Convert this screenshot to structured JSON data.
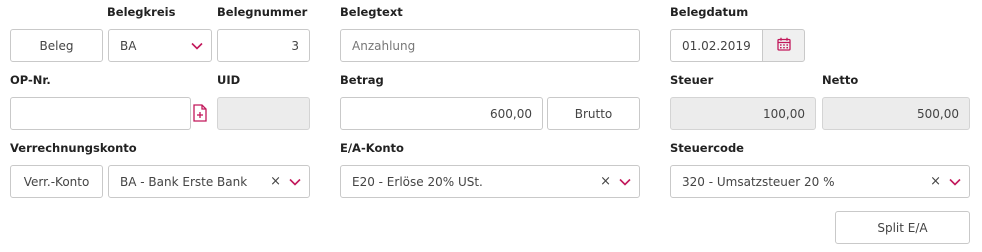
{
  "labels": {
    "belegkreis": "Belegkreis",
    "belegnummer": "Belegnummer",
    "belegtext": "Belegtext",
    "belegdatum": "Belegdatum",
    "op_nr": "OP-Nr.",
    "uid": "UID",
    "betrag": "Betrag",
    "steuer": "Steuer",
    "netto": "Netto",
    "verrechnungskonto": "Verrechnungskonto",
    "ea_konto": "E/A-Konto",
    "steuercode": "Steuercode"
  },
  "row1": {
    "beleg_button": "Beleg",
    "belegkreis_value": "BA",
    "belegnummer_value": "3",
    "belegtext_placeholder": "Anzahlung",
    "belegdatum_value": "01.02.2019"
  },
  "row2": {
    "op_nr_value": "",
    "uid_value": "",
    "betrag_value": "600,00",
    "brutto_button": "Brutto",
    "steuer_value": "100,00",
    "netto_value": "500,00"
  },
  "row3": {
    "verr_konto_button": "Verr.-Konto",
    "verrechnungskonto_value": "BA - Bank Erste Bank",
    "ea_konto_value": "E20 - Erlöse 20% USt.",
    "steuercode_value": "320 - Umsatzsteuer 20 %"
  },
  "actions": {
    "split_button": "Split E/A"
  },
  "icons": {
    "clear": "×",
    "calendar": "calendar-icon",
    "add_document": "document-add-icon",
    "chevron": "chevron-down-icon"
  },
  "colors": {
    "accent": "#c2185b"
  }
}
